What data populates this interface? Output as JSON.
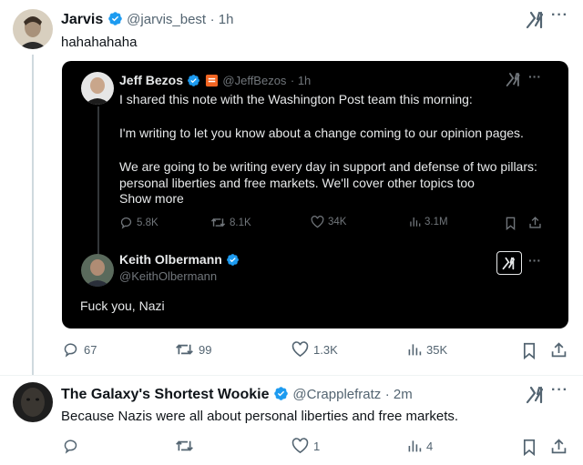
{
  "tweet1": {
    "name": "Jarvis",
    "handle": "@jarvis_best",
    "time": "· 1h",
    "text": "hahahahaha",
    "actions": {
      "reply": "67",
      "retweet": "99",
      "like": "1.3K",
      "views": "35K"
    }
  },
  "quote": {
    "tweet": {
      "name": "Jeff Bezos",
      "handle": "@JeffBezos",
      "time": "· 1h",
      "line1": "I shared this note with the Washington Post team this morning:",
      "line2": "I'm writing to let you know about a change coming to our opinion pages.",
      "line3": "We are going to be writing every day in support and defense of two pillars:",
      "line4": "personal liberties and free markets. We'll cover other topics too",
      "show_more": "Show more",
      "actions": {
        "reply": "5.8K",
        "retweet": "8.1K",
        "like": "34K",
        "views": "3.1M"
      }
    },
    "reply": {
      "name": "Keith Olbermann",
      "handle": "@KeithOlbermann",
      "text": "Fuck you, Nazi"
    }
  },
  "tweet2": {
    "name": "The Galaxy's Shortest Wookie",
    "handle": "@Crapplefratz",
    "time": "· 2m",
    "text": "Because Nazis were all about personal liberties and free markets.",
    "actions": {
      "reply": "",
      "retweet": "",
      "like": "1",
      "views": "4"
    }
  },
  "colors": {
    "verified": "#1d9bf0",
    "muted": "#536471",
    "card_bg": "#000000"
  },
  "icons": [
    "verified-badge-icon",
    "grok-icon",
    "more-icon",
    "reply-icon",
    "retweet-icon",
    "like-icon",
    "views-icon",
    "bookmark-icon",
    "share-icon"
  ]
}
